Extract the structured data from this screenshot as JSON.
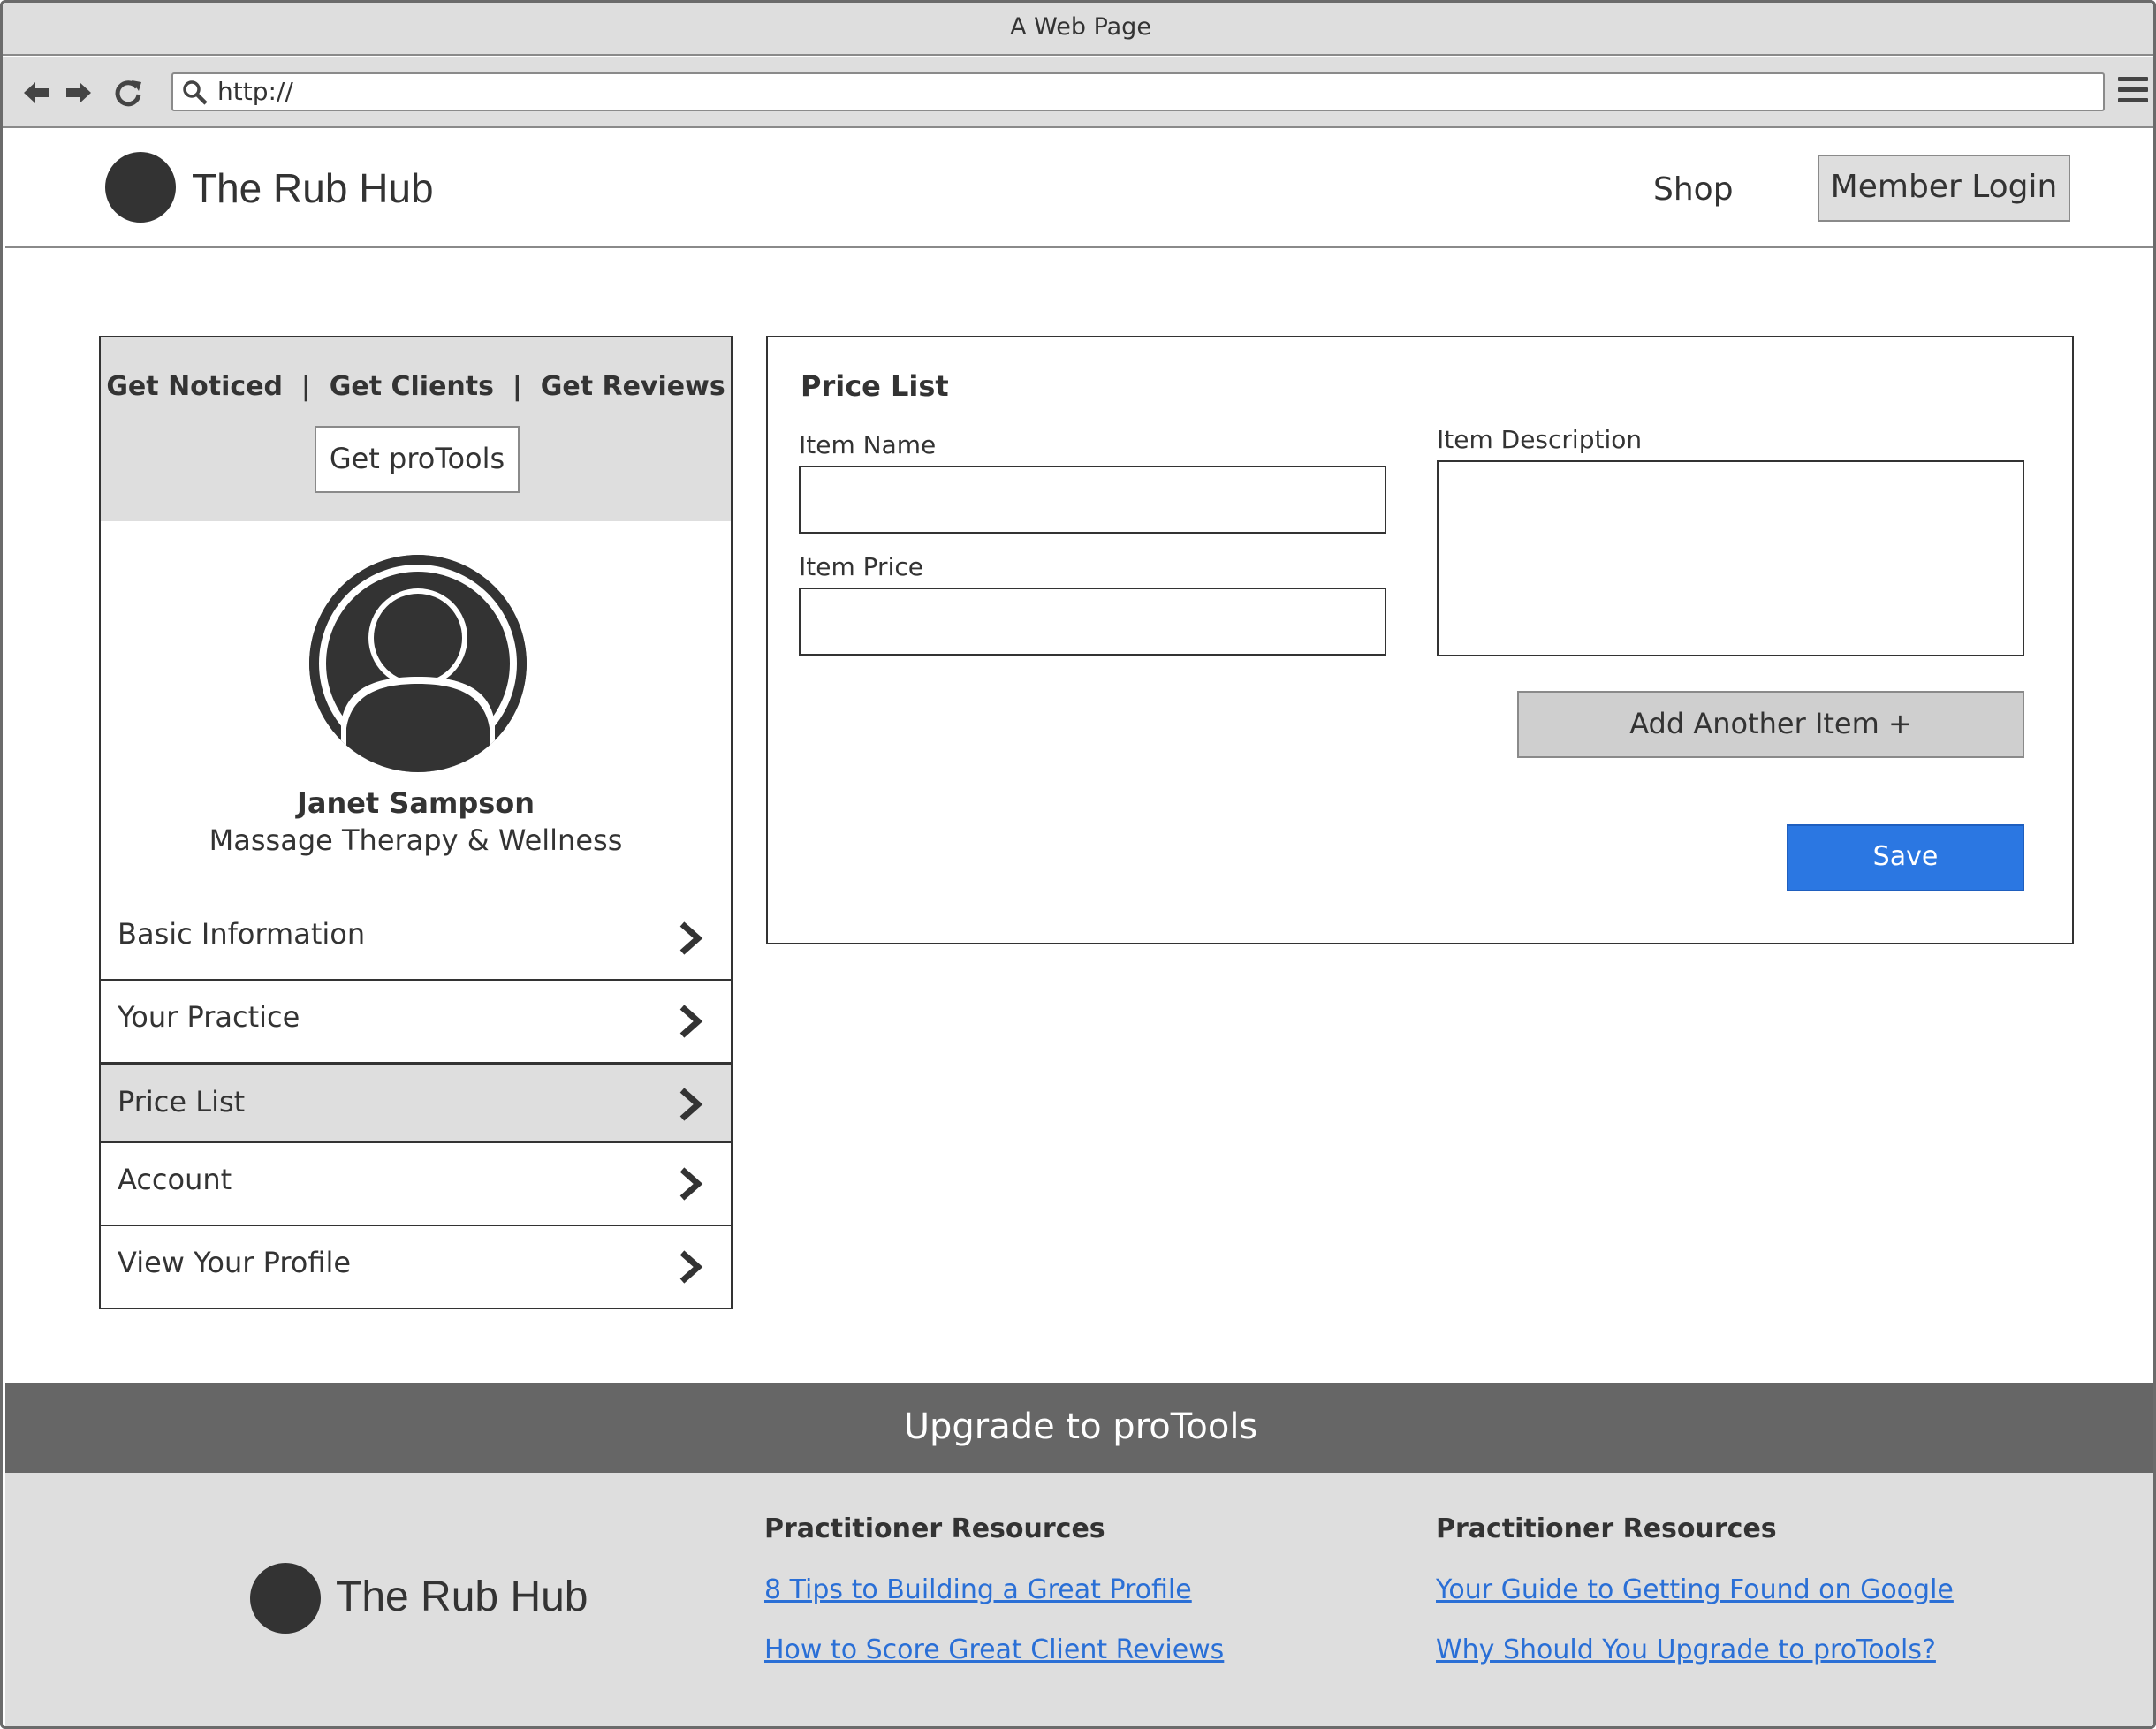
{
  "browser": {
    "window_title": "A Web Page",
    "url": "http://"
  },
  "header": {
    "brand": "The Rub Hub",
    "shop_label": "Shop",
    "login_label": "Member Login"
  },
  "promo": {
    "line": "Get Noticed  |  Get Clients  |  Get Reviews",
    "button_label": "Get proTools"
  },
  "profile": {
    "name": "Janet Sampson",
    "subtitle": "Massage Therapy & Wellness"
  },
  "sidebar": {
    "items": [
      {
        "label": "Basic Information"
      },
      {
        "label": "Your Practice"
      },
      {
        "label": "Price List"
      },
      {
        "label": "Account"
      },
      {
        "label": "View Your Profile"
      }
    ],
    "active_index": 2
  },
  "price_list": {
    "title": "Price List",
    "item_name_label": "Item Name",
    "item_name_value": "",
    "item_price_label": "Item Price",
    "item_price_value": "",
    "item_description_label": "Item Description",
    "item_description_value": "",
    "add_button_label": "Add Another Item  +",
    "save_button_label": "Save"
  },
  "footer": {
    "upgrade_label": "Upgrade to proTools",
    "brand": "The Rub Hub",
    "columns": [
      {
        "heading": "Practitioner Resources",
        "links": [
          "8 Tips to Building a Great Profile",
          "How to Score Great Client Reviews"
        ]
      },
      {
        "heading": "Practitioner Resources",
        "links": [
          "Your Guide to Getting Found on Google",
          "Why Should You Upgrade to proTools?"
        ]
      }
    ]
  },
  "colors": {
    "accent_blue": "#2b77e2",
    "chrome_gray": "#dedede",
    "dark": "#333333",
    "upgrade_bar": "#666666",
    "link_blue": "#2a6fd6"
  }
}
